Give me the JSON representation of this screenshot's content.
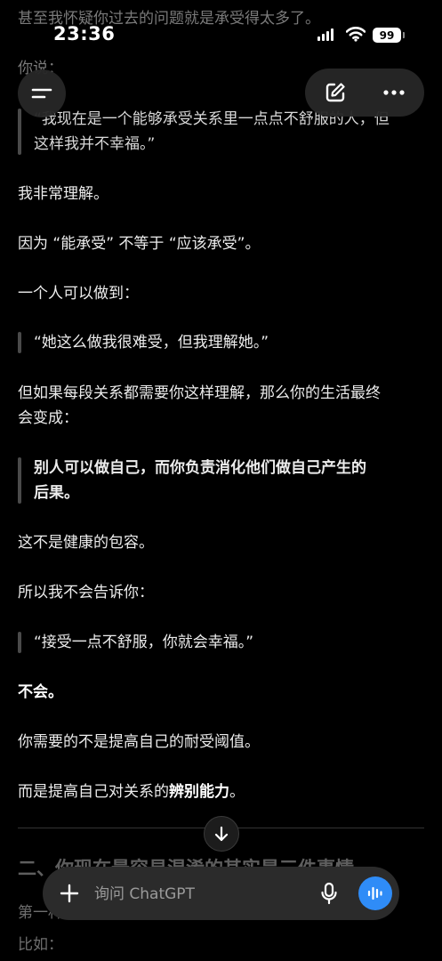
{
  "status_bar": {
    "time": "23:36",
    "battery": "99"
  },
  "conversation": {
    "faded_top_line": "甚至我怀疑你过去的问题就是承受得太多了。",
    "faded_label": "你说：",
    "user_quote_line1": "“我现在是一个能够承受关系里一点点不舒服的人，但",
    "user_quote_line2": "这样我并不幸福。”",
    "p1": "我非常理解。",
    "p2": "因为 “能承受” 不等于 “应该承受”。",
    "p3": "一个人可以做到：",
    "quote2": "“她这么做我很难受，但我理解她。”",
    "p4_line1": "但如果每段关系都需要你这样理解，那么你的生活最终",
    "p4_line2": "会变成：",
    "quote3_line1": "别人可以做自己，而你负责消化他们做自己产生的",
    "quote3_line2": "后果。",
    "p5": "这不是健康的包容。",
    "p6": "所以我不会告诉你：",
    "quote4": "“接受一点不舒服，你就会幸福。”",
    "p7": "不会。",
    "p8": "你需要的不是提高自己的耐受阈值。",
    "p9_prefix": "而是提高自己对关系的",
    "p9_bold": "辨别能力",
    "p9_suffix": "。",
    "faded_heading": "二、你现在最容易混淆的其实是三件事情",
    "faded_sub": "第一种",
    "faded_bottom": "比如："
  },
  "composer": {
    "placeholder": "询问 ChatGPT"
  },
  "icons": {
    "menu": "menu-icon",
    "new_chat": "edit-icon",
    "more": "more-icon",
    "scroll_down": "arrow-down-icon",
    "plus": "plus-icon",
    "mic": "mic-icon",
    "voice": "voice-mode-icon"
  },
  "colors": {
    "background": "#000000",
    "text": "#ececec",
    "voice_button": "#2f8cf7"
  }
}
